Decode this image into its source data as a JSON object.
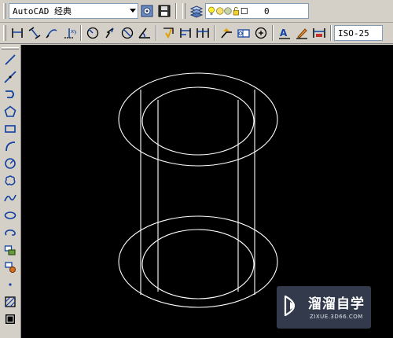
{
  "workspace": {
    "selected": "AutoCAD 经典"
  },
  "layer": {
    "current": "0"
  },
  "dim_style": {
    "current": "ISO-25"
  },
  "toolbar_row1": {
    "icons": [
      "workspace-settings-icon",
      "workspace-save-icon",
      "layer-manager-icon",
      "light-bulb-icon",
      "sun-icon",
      "freeze-icon",
      "lock-icon",
      "color-swatch-icon"
    ]
  },
  "toolbar_row2": {
    "icons": [
      "linear-dim-icon",
      "aligned-dim-icon",
      "arc-length-dim-icon",
      "ordinate-dim-icon",
      "radius-dim-icon",
      "jogged-dim-icon",
      "diameter-dim-icon",
      "angular-dim-icon",
      "quick-dim-icon",
      "baseline-dim-icon",
      "continue-dim-icon",
      "quick-leader-icon",
      "tolerance-icon",
      "center-mark-icon",
      "dim-edit-icon",
      "dim-text-edit-icon",
      "dim-update-icon"
    ]
  },
  "draw_toolbar": {
    "tools": [
      "line-icon",
      "construction-line-icon",
      "polyline-icon",
      "polygon-icon",
      "rectangle-icon",
      "arc-icon",
      "circle-icon",
      "revcloud-icon",
      "spline-icon",
      "ellipse-icon",
      "ellipse-arc-icon",
      "insert-block-icon",
      "make-block-icon",
      "point-icon",
      "hatch-icon",
      "gradient-icon"
    ]
  },
  "watermark": {
    "title": "溜溜自学",
    "subtitle": "ZIXUE.3D66.COM"
  },
  "colors": {
    "canvas_bg": "#000000",
    "drawing_stroke": "#ffffff",
    "toolbar_bg": "#d4d0c8",
    "accent_blue": "#2a5caa"
  }
}
